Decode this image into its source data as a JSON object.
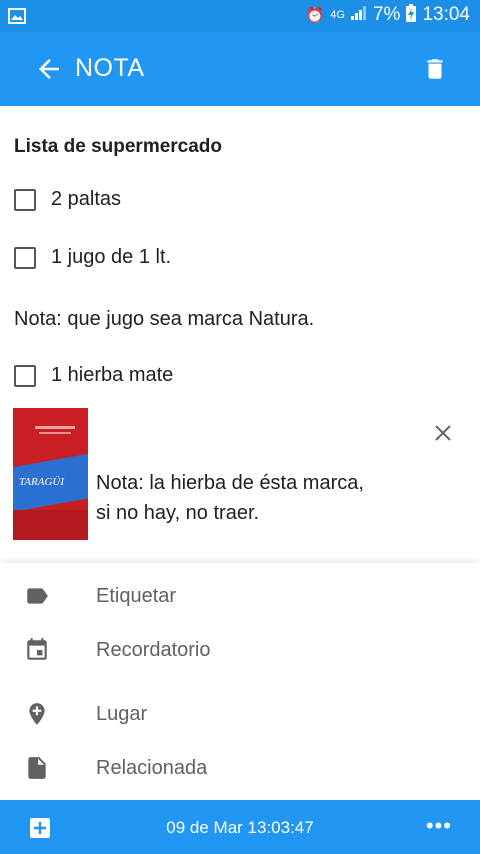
{
  "status_bar": {
    "battery": "7%",
    "time": "13:04",
    "network": "4G"
  },
  "app_bar": {
    "title": "NOTA"
  },
  "note": {
    "title": "Lista de supermercado",
    "items": [
      {
        "label": "2 paltas",
        "checked": false
      },
      {
        "label": "1 jugo de 1 lt.",
        "checked": false
      },
      {
        "label": "1 hierba mate",
        "checked": false
      }
    ],
    "note_line": "Nota: que jugo sea marca Natura.",
    "attachment": {
      "brand": "TARAGÜI",
      "caption_line1": "Nota: la hierba de ésta marca,",
      "caption_line2": "si no hay, no traer."
    }
  },
  "menu": {
    "items": [
      {
        "label": "Etiquetar",
        "icon": "label-icon"
      },
      {
        "label": "Recordatorio",
        "icon": "calendar-icon"
      },
      {
        "label": "Lugar",
        "icon": "add-location-icon"
      },
      {
        "label": "Relacionada",
        "icon": "file-icon"
      }
    ]
  },
  "bottom_bar": {
    "date": "09 de Mar 13:03:47"
  },
  "colors": {
    "primary": "#2196f3",
    "status_bar": "#1e8fe6"
  }
}
